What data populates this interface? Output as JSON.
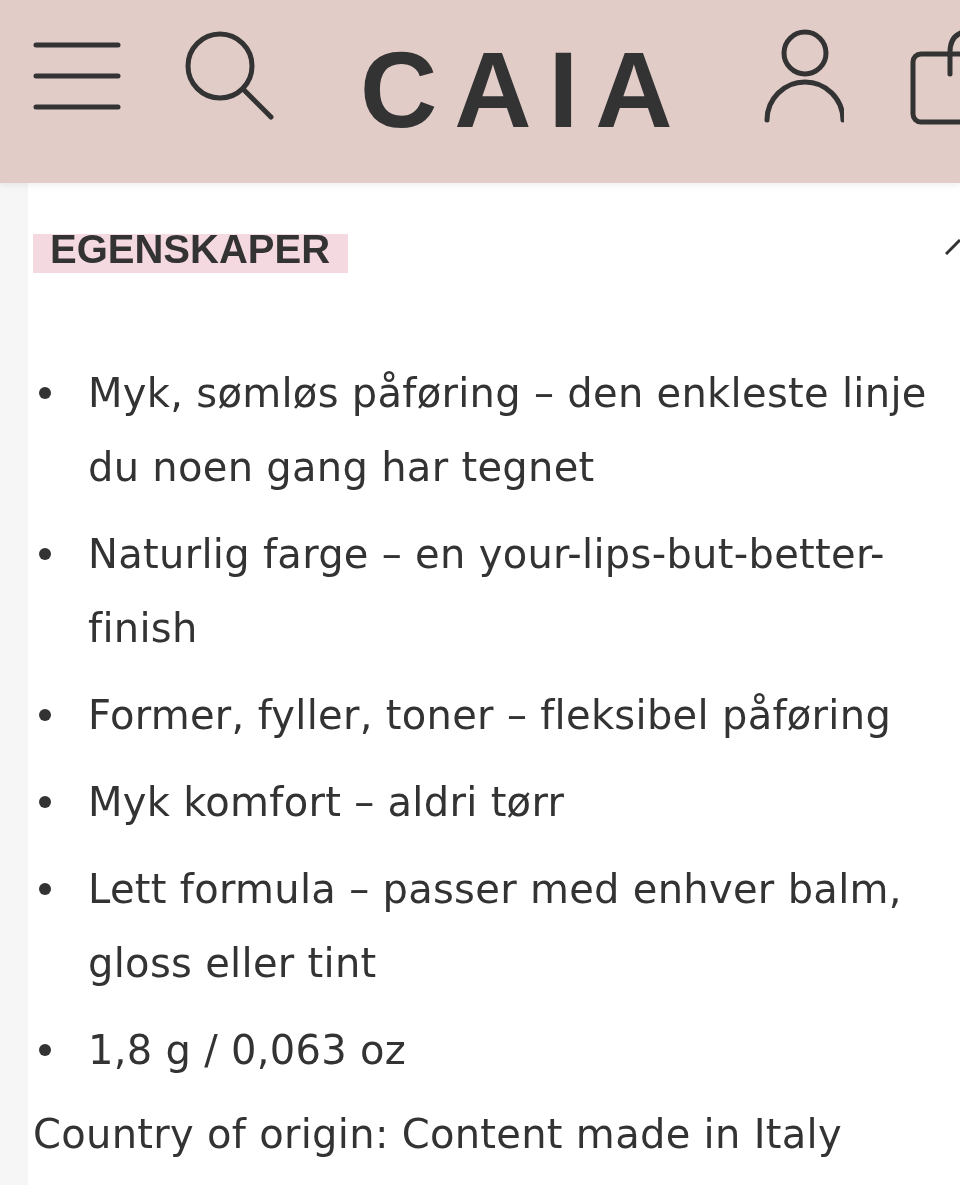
{
  "header": {
    "logo": "CAIA"
  },
  "section": {
    "title": "EGENSKAPER",
    "expanded": true,
    "items": [
      "Myk, sømløs påføring – den enkleste linje du noen gang har tegnet",
      "Naturlig farge – en your-lips-but-better-finish",
      "Former, fyller, toner – fleksibel påføring",
      "Myk komfort – aldri tørr",
      "Lett formula – passer med enhver balm, gloss eller tint",
      "1,8 g / 0,063 oz"
    ],
    "origin": "Country of origin: Content made in Italy"
  }
}
